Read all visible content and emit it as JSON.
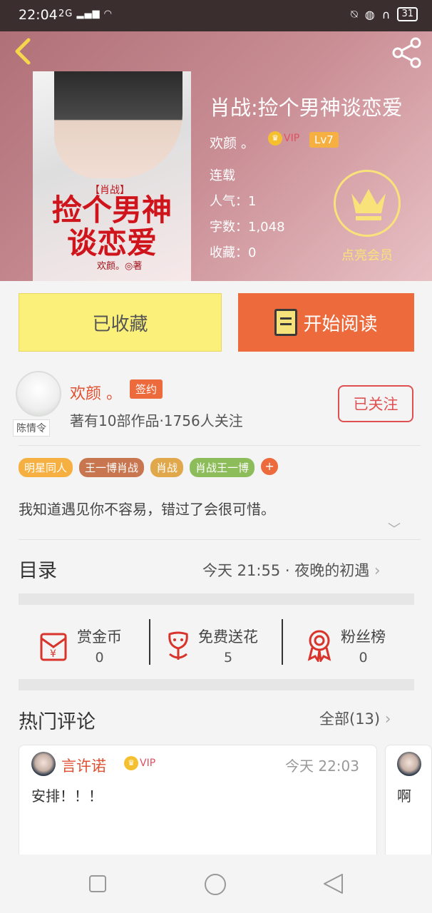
{
  "status_bar": {
    "time": "22:04",
    "network": "2G",
    "battery": "31"
  },
  "book": {
    "title": "肖战:捡个男神谈恋爱",
    "author": "欢颜 。",
    "vip_label": "VIP",
    "level": "Lv7",
    "status": "连载",
    "popularity": "人气：1",
    "word_count": "字数：1,048",
    "favorites": "收藏：0",
    "cover": {
      "tag": "【肖战】",
      "title_line1": "捡个男神",
      "title_line2": "谈恋爱",
      "author": "欢颜。◎著"
    }
  },
  "member": {
    "label": "点亮会员"
  },
  "actions": {
    "collected_label": "已收藏",
    "read_label": "开始阅读"
  },
  "author_info": {
    "name": "欢颜 。",
    "badge": "签约",
    "stats": "著有10部作品·1756人关注",
    "follow_label": "已关注",
    "avatar_tag": "陈情令"
  },
  "tags": [
    {
      "label": "明星同人",
      "color": "#f5b041"
    },
    {
      "label": "王一博肖战",
      "color": "#c8764f"
    },
    {
      "label": "肖战",
      "color": "#e0a84a"
    },
    {
      "label": "肖战王一博",
      "color": "#8cbd5a"
    }
  ],
  "description": "我知道遇见你不容易，错过了会很可惜。",
  "toc": {
    "title": "目录",
    "latest": "今天 21:55 · 夜晚的初遇"
  },
  "rewards": [
    {
      "label": "赏金币",
      "value": "0",
      "icon": "red-envelope-icon"
    },
    {
      "label": "免费送花",
      "value": "5",
      "icon": "flower-icon"
    },
    {
      "label": "粉丝榜",
      "value": "0",
      "icon": "ribbon-badge-icon"
    }
  ],
  "comments": {
    "title": "热门评论",
    "all_label": "全部(13)",
    "items": [
      {
        "user": "言许诺",
        "vip": "VIP",
        "time": "今天 22:03",
        "text": "安排！！！"
      },
      {
        "user": "",
        "text": "啊"
      }
    ]
  },
  "colors": {
    "accent": "#ec6a3c",
    "gold": "#f9e27a",
    "collect_bg": "#fbf07a"
  }
}
